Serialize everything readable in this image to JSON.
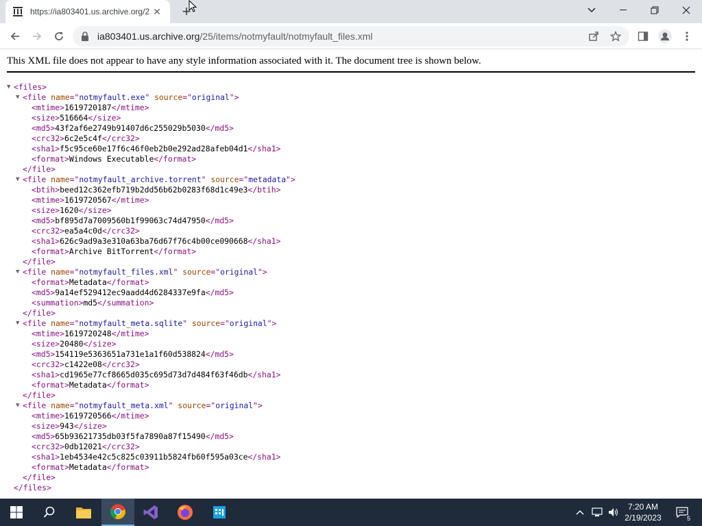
{
  "browser": {
    "tab_title": "https://ia803401.us.archive.org/2",
    "url_host": "ia803401.us.archive.org",
    "url_path": "/25/items/notmyfault/notmyfault_files.xml"
  },
  "page": {
    "notice": "This XML file does not appear to have any style information associated with it. The document tree is shown below.",
    "root_tag": "files",
    "files": [
      {
        "name": "notmyfault.exe",
        "source": "original",
        "children": [
          [
            "mtime",
            "1619720187"
          ],
          [
            "size",
            "516664"
          ],
          [
            "md5",
            "43f2af6e2749b91407d6c255029b5030"
          ],
          [
            "crc32",
            "6c2e5c4f"
          ],
          [
            "sha1",
            "f5c95ce60e17f6c46f0eb2b0e292ad28afeb04d1"
          ],
          [
            "format",
            "Windows Executable"
          ]
        ]
      },
      {
        "name": "notmyfault_archive.torrent",
        "source": "metadata",
        "children": [
          [
            "btih",
            "beed12c362efb719b2dd56b62b0283f68d1c49e3"
          ],
          [
            "mtime",
            "1619720567"
          ],
          [
            "size",
            "1620"
          ],
          [
            "md5",
            "bf895d7a7009560b1f99063c74d47950"
          ],
          [
            "crc32",
            "ea5a4c0d"
          ],
          [
            "sha1",
            "626c9ad9a3e310a63ba76d67f76c4b00ce090668"
          ],
          [
            "format",
            "Archive BitTorrent"
          ]
        ]
      },
      {
        "name": "notmyfault_files.xml",
        "source": "original",
        "children": [
          [
            "format",
            "Metadata"
          ],
          [
            "md5",
            "9a14ef529412ec9aadd4d6284337e9fa"
          ],
          [
            "summation",
            "md5"
          ]
        ]
      },
      {
        "name": "notmyfault_meta.sqlite",
        "source": "original",
        "children": [
          [
            "mtime",
            "1619720248"
          ],
          [
            "size",
            "20480"
          ],
          [
            "md5",
            "154119e5363651a731e1a1f60d538824"
          ],
          [
            "crc32",
            "c1422e08"
          ],
          [
            "sha1",
            "cd1965e77cf8665d035c695d73d7d484f63f46db"
          ],
          [
            "format",
            "Metadata"
          ]
        ]
      },
      {
        "name": "notmyfault_meta.xml",
        "source": "original",
        "children": [
          [
            "mtime",
            "1619720566"
          ],
          [
            "size",
            "943"
          ],
          [
            "md5",
            "65b93621735db03f5fa7890a87f15490"
          ],
          [
            "crc32",
            "0db12021"
          ],
          [
            "sha1",
            "1eb4534e42c5c825c03911b5824fb60f595a03ce"
          ],
          [
            "format",
            "Metadata"
          ]
        ]
      }
    ]
  },
  "taskbar": {
    "time": "7:20 AM",
    "date": "2/19/2023",
    "notification_count": "5"
  },
  "colors": {
    "tag": "#881280",
    "attr_name": "#994500",
    "attr_value": "#1a1aa6",
    "taskbar": "#1f2b3a"
  }
}
